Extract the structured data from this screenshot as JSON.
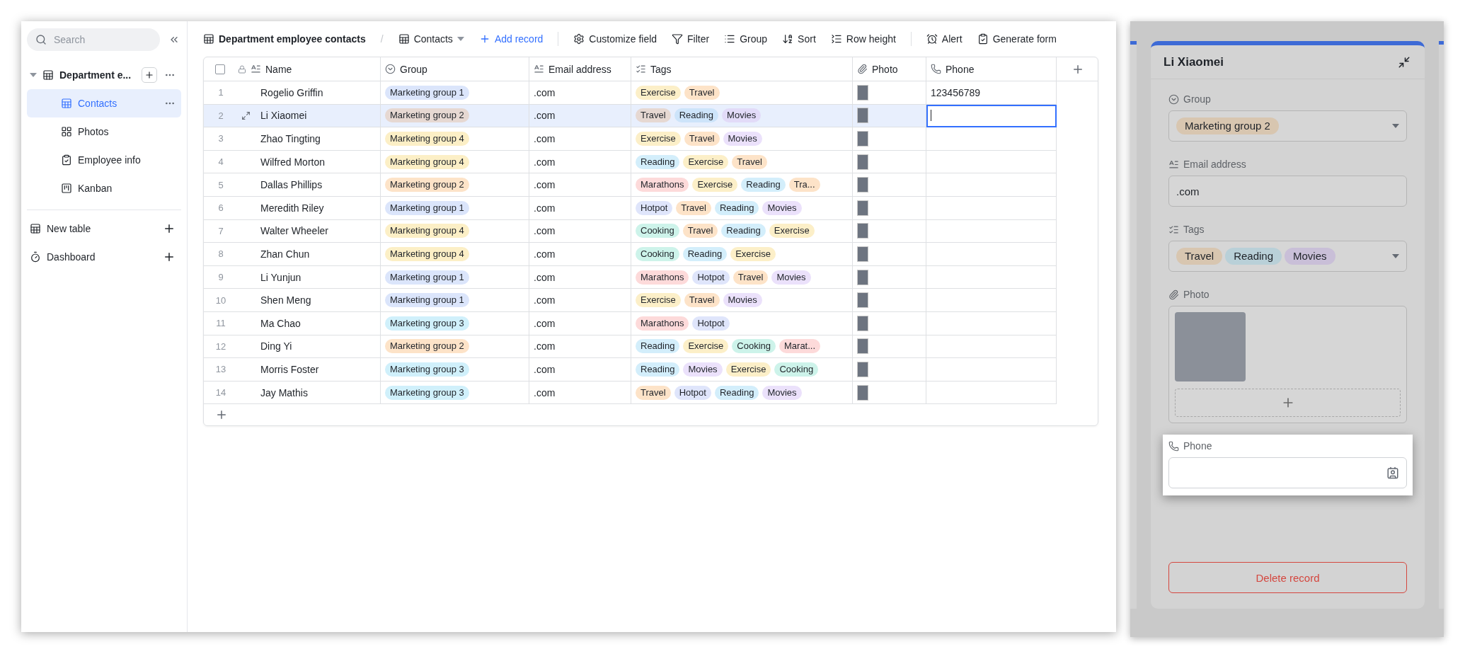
{
  "sidebar": {
    "search": {
      "placeholder": "Search"
    },
    "tree": [
      {
        "label": "Department e...",
        "kind": "table",
        "expanded": true,
        "children": [
          {
            "label": "Contacts",
            "kind": "grid",
            "selected": true
          },
          {
            "label": "Photos",
            "kind": "gallery",
            "selected": false
          },
          {
            "label": "Employee info",
            "kind": "form",
            "selected": false
          },
          {
            "label": "Kanban",
            "kind": "kanban",
            "selected": false
          }
        ]
      }
    ],
    "items": [
      {
        "label": "New table",
        "kind": "table"
      },
      {
        "label": "Dashboard",
        "kind": "dashboard"
      }
    ]
  },
  "toolbar": {
    "breadcrumb": "Department employee contacts",
    "separator": "/",
    "view": "Contacts",
    "add_record": "Add record",
    "tool_groups": [
      [
        {
          "label": "Customize field",
          "kind": "settings"
        },
        {
          "label": "Filter",
          "kind": "filter"
        },
        {
          "label": "Group",
          "kind": "group"
        },
        {
          "label": "Sort",
          "kind": "sort"
        },
        {
          "label": "Row height",
          "kind": "rowheight"
        }
      ],
      [
        {
          "label": "Alert",
          "kind": "alarm"
        },
        {
          "label": "Generate form",
          "kind": "form"
        }
      ]
    ]
  },
  "table": {
    "select_all": {
      "checked": false
    },
    "columns": [
      {
        "label": "Name",
        "kind": "text"
      },
      {
        "label": "Group",
        "kind": "select"
      },
      {
        "label": "Email address",
        "kind": "text"
      },
      {
        "label": "Tags",
        "kind": "multiselect"
      },
      {
        "label": "Photo",
        "kind": "attachment"
      },
      {
        "label": "Phone",
        "kind": "phone"
      }
    ],
    "rows": [
      {
        "number": "1",
        "name": "Rogelio Griffin",
        "group": {
          "label": "Marketing group 1",
          "color": "#dbe5fb"
        },
        "email": ".com",
        "tags": [
          {
            "label": "Exercise",
            "color": "#fcefc8"
          },
          {
            "label": "Travel",
            "color": "#fde3c8"
          }
        ],
        "phone": "123456789",
        "selected": false,
        "editing": false
      },
      {
        "number": "2",
        "name": "Li Xiaomei",
        "group": {
          "label": "Marketing group 2",
          "color": "#e6d8d2"
        },
        "email": ".com",
        "tags": [
          {
            "label": "Travel",
            "color": "#e6d8d2"
          },
          {
            "label": "Reading",
            "color": "#cde4fa"
          },
          {
            "label": "Movies",
            "color": "#e2dbf8"
          }
        ],
        "selected": true,
        "editing": true
      },
      {
        "number": "3",
        "name": "Zhao Tingting",
        "group": {
          "label": "Marketing group 4",
          "color": "#fcefc6"
        },
        "email": ".com",
        "tags": [
          {
            "label": "Exercise",
            "color": "#fcefc8"
          },
          {
            "label": "Travel",
            "color": "#fde3c8"
          },
          {
            "label": "Movies",
            "color": "#ebe1fb"
          }
        ],
        "selected": false,
        "editing": false
      },
      {
        "number": "4",
        "name": "Wilfred Morton",
        "group": {
          "label": "Marketing group 4",
          "color": "#fcefc6"
        },
        "email": ".com",
        "tags": [
          {
            "label": "Reading",
            "color": "#d3eefb"
          },
          {
            "label": "Exercise",
            "color": "#fcefc8"
          },
          {
            "label": "Travel",
            "color": "#fde3c8"
          }
        ],
        "selected": false,
        "editing": false
      },
      {
        "number": "5",
        "name": "Dallas Phillips",
        "group": {
          "label": "Marketing group 2",
          "color": "#fde3c8"
        },
        "email": ".com",
        "tags": [
          {
            "label": "Marathons",
            "color": "#fddada"
          },
          {
            "label": "Exercise",
            "color": "#fcefc8"
          },
          {
            "label": "Reading",
            "color": "#d3eefb"
          },
          {
            "label": "Tra...",
            "color": "#fde3c8"
          }
        ],
        "selected": false,
        "editing": false
      },
      {
        "number": "6",
        "name": "Meredith Riley",
        "group": {
          "label": "Marketing group 1",
          "color": "#dbe5fb"
        },
        "email": ".com",
        "tags": [
          {
            "label": "Hotpot",
            "color": "#dfe5fb"
          },
          {
            "label": "Travel",
            "color": "#fde3c8"
          },
          {
            "label": "Reading",
            "color": "#d3eefb"
          },
          {
            "label": "Movies",
            "color": "#ebe1fb"
          }
        ],
        "selected": false,
        "editing": false
      },
      {
        "number": "7",
        "name": "Walter Wheeler",
        "group": {
          "label": "Marketing group 4",
          "color": "#fcefc6"
        },
        "email": ".com",
        "tags": [
          {
            "label": "Cooking",
            "color": "#cdf3ea"
          },
          {
            "label": "Travel",
            "color": "#fde3c8"
          },
          {
            "label": "Reading",
            "color": "#d3eefb"
          },
          {
            "label": "Exercise",
            "color": "#fcefc8"
          }
        ],
        "selected": false,
        "editing": false
      },
      {
        "number": "8",
        "name": "Zhan Chun",
        "group": {
          "label": "Marketing group 4",
          "color": "#fcefc6"
        },
        "email": ".com",
        "tags": [
          {
            "label": "Cooking",
            "color": "#cdf3ea"
          },
          {
            "label": "Reading",
            "color": "#d3eefb"
          },
          {
            "label": "Exercise",
            "color": "#fcefc8"
          }
        ],
        "selected": false,
        "editing": false
      },
      {
        "number": "9",
        "name": "Li Yunjun",
        "group": {
          "label": "Marketing group 1",
          "color": "#dbe5fb"
        },
        "email": ".com",
        "tags": [
          {
            "label": "Marathons",
            "color": "#fddada"
          },
          {
            "label": "Hotpot",
            "color": "#dfe5fb"
          },
          {
            "label": "Travel",
            "color": "#fde3c8"
          },
          {
            "label": "Movies",
            "color": "#ebe1fb"
          }
        ],
        "selected": false,
        "editing": false
      },
      {
        "number": "10",
        "name": "Shen Meng",
        "group": {
          "label": "Marketing group 1",
          "color": "#dbe5fb"
        },
        "email": ".com",
        "tags": [
          {
            "label": "Exercise",
            "color": "#fcefc8"
          },
          {
            "label": "Travel",
            "color": "#fde3c8"
          },
          {
            "label": "Movies",
            "color": "#ebe1fb"
          }
        ],
        "selected": false,
        "editing": false
      },
      {
        "number": "11",
        "name": "Ma Chao",
        "group": {
          "label": "Marketing group 3",
          "color": "#d0f0fb"
        },
        "email": ".com",
        "tags": [
          {
            "label": "Marathons",
            "color": "#fddada"
          },
          {
            "label": "Hotpot",
            "color": "#dfe5fb"
          }
        ],
        "selected": false,
        "editing": false
      },
      {
        "number": "12",
        "name": "Ding Yi",
        "group": {
          "label": "Marketing group 2",
          "color": "#fde3c8"
        },
        "email": ".com",
        "tags": [
          {
            "label": "Reading",
            "color": "#d3eefb"
          },
          {
            "label": "Exercise",
            "color": "#fcefc8"
          },
          {
            "label": "Cooking",
            "color": "#cdf3ea"
          },
          {
            "label": "Marat...",
            "color": "#fddada"
          }
        ],
        "selected": false,
        "editing": false
      },
      {
        "number": "13",
        "name": "Morris Foster",
        "group": {
          "label": "Marketing group 3",
          "color": "#d0f0fb"
        },
        "email": ".com",
        "tags": [
          {
            "label": "Reading",
            "color": "#d3eefb"
          },
          {
            "label": "Movies",
            "color": "#ebe1fb"
          },
          {
            "label": "Exercise",
            "color": "#fcefc8"
          },
          {
            "label": "Cooking",
            "color": "#cdf3ea"
          }
        ],
        "selected": false,
        "editing": false
      },
      {
        "number": "14",
        "name": "Jay Mathis",
        "group": {
          "label": "Marketing group 3",
          "color": "#d0f0fb"
        },
        "email": ".com",
        "tags": [
          {
            "label": "Travel",
            "color": "#fde3c8"
          },
          {
            "label": "Hotpot",
            "color": "#dfe5fb"
          },
          {
            "label": "Reading",
            "color": "#d3eefb"
          },
          {
            "label": "Movies",
            "color": "#ebe1fb"
          }
        ],
        "selected": false,
        "editing": false
      }
    ]
  },
  "record": {
    "title": "Li Xiaomei",
    "fields": [
      {
        "kind": "select",
        "label": "Group",
        "tags": [
          {
            "label": "Marketing group 2",
            "color": "#d8c6b0"
          }
        ],
        "highlighted": false
      },
      {
        "kind": "text",
        "label": "Email address",
        "value": ".com",
        "highlighted": false
      },
      {
        "kind": "multiselect",
        "label": "Tags",
        "tags": [
          {
            "label": "Travel",
            "color": "#d8c6b0"
          },
          {
            "label": "Reading",
            "color": "#b9d0d8"
          },
          {
            "label": "Movies",
            "color": "#c9bfd8"
          }
        ],
        "highlighted": false
      },
      {
        "kind": "attachment",
        "label": "Photo",
        "highlighted": false
      },
      {
        "kind": "phone",
        "label": "Phone",
        "highlighted": true
      }
    ],
    "delete": "Delete record"
  }
}
